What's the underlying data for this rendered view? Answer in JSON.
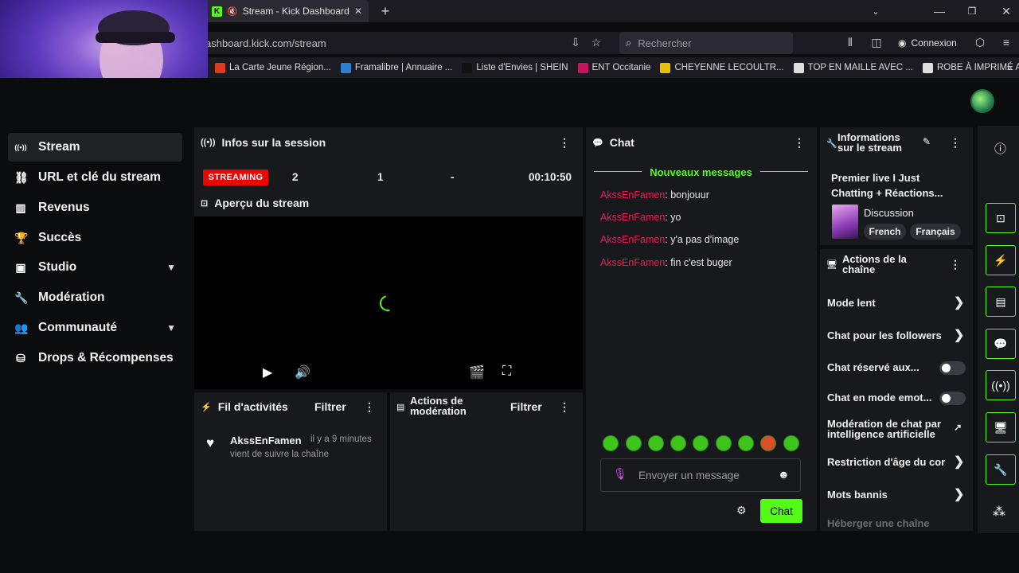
{
  "browser": {
    "tab_title": "Stream - Kick Dashboard",
    "tab_favicon": "K",
    "url": "ashboard.kick.com/stream",
    "url_host": "kick.com",
    "search_placeholder": "Rechercher",
    "connexion_label": "Connexion",
    "bookmarks": [
      {
        "label": "La Carte Jeune Région...",
        "color": "#e03a1e"
      },
      {
        "label": "Framalibre | Annuaire ...",
        "color": "#2f7fd1"
      },
      {
        "label": "Liste d'Envies | SHEIN",
        "color": "#111111",
        "glyph": "S"
      },
      {
        "label": "ENT Occitanie",
        "color": "#c2185b"
      },
      {
        "label": "CHEYENNE LECOULTR...",
        "color": "#e6c200"
      },
      {
        "label": "TOP EN MAILLE AVEC ...",
        "color": "#dddddd"
      },
      {
        "label": "ROBE À IMPRIMÉ ANI...",
        "color": "#dddddd"
      }
    ]
  },
  "sidebar": {
    "items": [
      {
        "label": "Stream",
        "icon": "broadcast-icon",
        "glyph": "((•))"
      },
      {
        "label": "URL et clé du stream",
        "icon": "link-icon",
        "glyph": "⛓"
      },
      {
        "label": "Revenus",
        "icon": "chart-icon",
        "glyph": "▥"
      },
      {
        "label": "Succès",
        "icon": "trophy-icon",
        "glyph": "🏆"
      },
      {
        "label": "Studio",
        "icon": "studio-icon",
        "glyph": "▣"
      },
      {
        "label": "Modération",
        "icon": "wrench-icon",
        "glyph": "🔧"
      },
      {
        "label": "Communauté",
        "icon": "users-icon",
        "glyph": "👥"
      },
      {
        "label": "Drops & Récompenses",
        "icon": "gift-icon",
        "glyph": "⛁"
      }
    ]
  },
  "session": {
    "title": "Infos sur la session",
    "status": "STREAMING",
    "viewers": "2",
    "followers": "1",
    "dash": "-",
    "duration": "00:10:50"
  },
  "preview": {
    "title": "Aperçu du stream"
  },
  "activity": {
    "title": "Fil d'activités",
    "filter_label": "Filtrer",
    "items": [
      {
        "user": "AkssEnFamen",
        "time": "il y a 9 minutes",
        "text": "vient de suivre la chaîne"
      }
    ]
  },
  "mod_actions": {
    "title": "Actions de modération",
    "filter_label": "Filtrer"
  },
  "chat": {
    "title": "Chat",
    "new_messages": "Nouveaux messages",
    "messages": [
      {
        "user": "AkssEnFamen",
        "text": ": bonjouur"
      },
      {
        "user": "AkssEnFamen",
        "text": ": yo"
      },
      {
        "user": "AkssEnFamen",
        "text": ": y'a pas d'image"
      },
      {
        "user": "AkssEnFamen",
        "text": ": fin c'est buger"
      }
    ],
    "input_placeholder": "Envoyer un message",
    "send_label": "Chat",
    "accent": "#53fc18",
    "username_color": "#eb1b55"
  },
  "stream_info": {
    "title": "Informations sur le stream",
    "stream_title": "Premier live I Just Chatting + Réactions...",
    "category": "Discussion",
    "tags": [
      "French",
      "Français"
    ]
  },
  "channel_actions": {
    "title": "Actions de la chaîne",
    "items": [
      {
        "label": "Mode lent",
        "control": "chevron"
      },
      {
        "label": "Chat pour les followers",
        "control": "chevron"
      },
      {
        "label": "Chat réservé aux...",
        "control": "toggle"
      },
      {
        "label": "Chat en mode emot...",
        "control": "toggle"
      },
      {
        "label": "Modération de chat par intelligence artificielle",
        "control": "external"
      },
      {
        "label": "Restriction d'âge du cor",
        "control": "chevron"
      },
      {
        "label": "Mots bannis",
        "control": "chevron"
      },
      {
        "label": "Héberger une chaîne",
        "control": "none"
      }
    ]
  }
}
